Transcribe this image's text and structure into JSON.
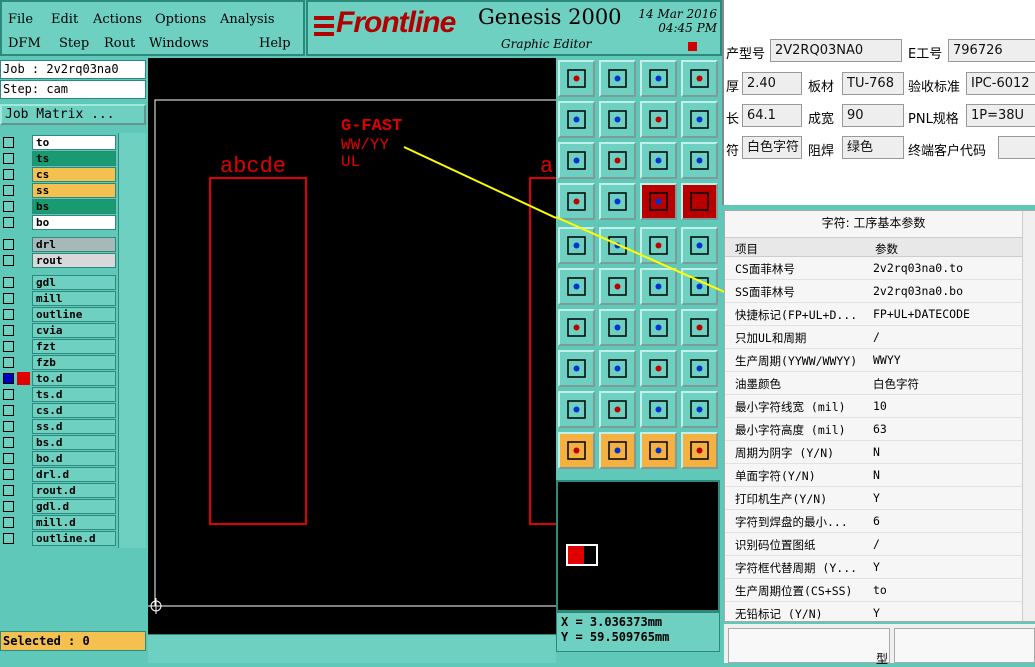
{
  "menu": {
    "row1": [
      "File",
      "Edit",
      "Actions",
      "Options",
      "Analysis"
    ],
    "row2": [
      "DFM",
      "Step",
      "Rout",
      "Windows",
      "Help"
    ]
  },
  "header": {
    "logo": "Frontline",
    "product": "Genesis 2000",
    "subtitle": "Graphic Editor",
    "date": "14 Mar 2016",
    "time": "04:45 PM"
  },
  "job": {
    "job_label": "Job : 2v2rq03na0",
    "step_label": "Step: cam",
    "matrix_button": "Job Matrix ..."
  },
  "layers": [
    {
      "name": "to",
      "color": "#ffffff"
    },
    {
      "name": "ts",
      "color": "#1a9a70"
    },
    {
      "name": "cs",
      "color": "#f4c050"
    },
    {
      "name": "ss",
      "color": "#f4c050"
    },
    {
      "name": "bs",
      "color": "#1a9a70"
    },
    {
      "name": "bo",
      "color": "#ffffff"
    },
    {
      "name": "drl",
      "color": "#a8b8b8"
    },
    {
      "name": "rout",
      "color": "#d8d8d8"
    },
    {
      "name": "gdl",
      "color": "#6ed0c0"
    },
    {
      "name": "mill",
      "color": "#6ed0c0"
    },
    {
      "name": "outline",
      "color": "#6ed0c0"
    },
    {
      "name": "cvia",
      "color": "#6ed0c0"
    },
    {
      "name": "fzt",
      "color": "#6ed0c0"
    },
    {
      "name": "fzb",
      "color": "#6ed0c0"
    },
    {
      "name": "to.d",
      "color": "#6ed0c0"
    },
    {
      "name": "ts.d",
      "color": "#6ed0c0"
    },
    {
      "name": "cs.d",
      "color": "#6ed0c0"
    },
    {
      "name": "ss.d",
      "color": "#6ed0c0"
    },
    {
      "name": "bs.d",
      "color": "#6ed0c0"
    },
    {
      "name": "bo.d",
      "color": "#6ed0c0"
    },
    {
      "name": "drl.d",
      "color": "#6ed0c0"
    },
    {
      "name": "rout.d",
      "color": "#6ed0c0"
    },
    {
      "name": "gdl.d",
      "color": "#6ed0c0"
    },
    {
      "name": "mill.d",
      "color": "#6ed0c0"
    },
    {
      "name": "outline.d",
      "color": "#6ed0c0"
    }
  ],
  "selected": "Selected : 0",
  "canvas": {
    "text_abcde": "abcde",
    "text_a": "a",
    "text_gfast": "G-FAST",
    "text_wwyy": "WW/YY",
    "text_ul": "UL"
  },
  "coords": {
    "x": "X  = 3.036373mm",
    "y": "Y  = 59.509765mm"
  },
  "form": {
    "labels": [
      "产型号",
      "E工号",
      "厚",
      "板材",
      "验收标准",
      "长",
      "成宽",
      "PNL规格",
      "符",
      "阻焊",
      "终端客户代码"
    ],
    "values": [
      "2V2RQ03NA0",
      "796726",
      "2.40",
      "TU-768",
      "IPC-6012",
      "64.1",
      "90",
      "1P=38U",
      "白色字符",
      "绿色",
      ""
    ]
  },
  "params": {
    "title": "字符: 工序基本参数",
    "col_item": "项目",
    "col_param": "参数",
    "rows": [
      {
        "item": "CS面菲林号",
        "value": "2v2rq03na0.to"
      },
      {
        "item": "SS面菲林号",
        "value": "2v2rq03na0.bo"
      },
      {
        "item": "快捷标记(FP+UL+D...",
        "value": "FP+UL+DATECODE"
      },
      {
        "item": "只加UL和周期",
        "value": "/"
      },
      {
        "item": "生产周期(YYWW/WWYY)",
        "value": "WWYY"
      },
      {
        "item": "油墨颜色",
        "value": "白色字符"
      },
      {
        "item": "最小字符线宽 (mil)",
        "value": "10"
      },
      {
        "item": "最小字符高度 (mil)",
        "value": "63"
      },
      {
        "item": "周期为阴字 (Y/N)",
        "value": "N"
      },
      {
        "item": "单面字符(Y/N)",
        "value": "N"
      },
      {
        "item": "打印机生产(Y/N)",
        "value": "Y"
      },
      {
        "item": "字符到焊盘的最小...",
        "value": "6"
      },
      {
        "item": "识别码位置图纸",
        "value": "/"
      },
      {
        "item": "字符框代替周期 (Y...",
        "value": "Y"
      },
      {
        "item": "生产周期位置(CS+SS)",
        "value": "to"
      },
      {
        "item": "无铅标记 (Y/N)",
        "value": "Y"
      }
    ]
  },
  "bottom_right": {
    "label": "型"
  }
}
